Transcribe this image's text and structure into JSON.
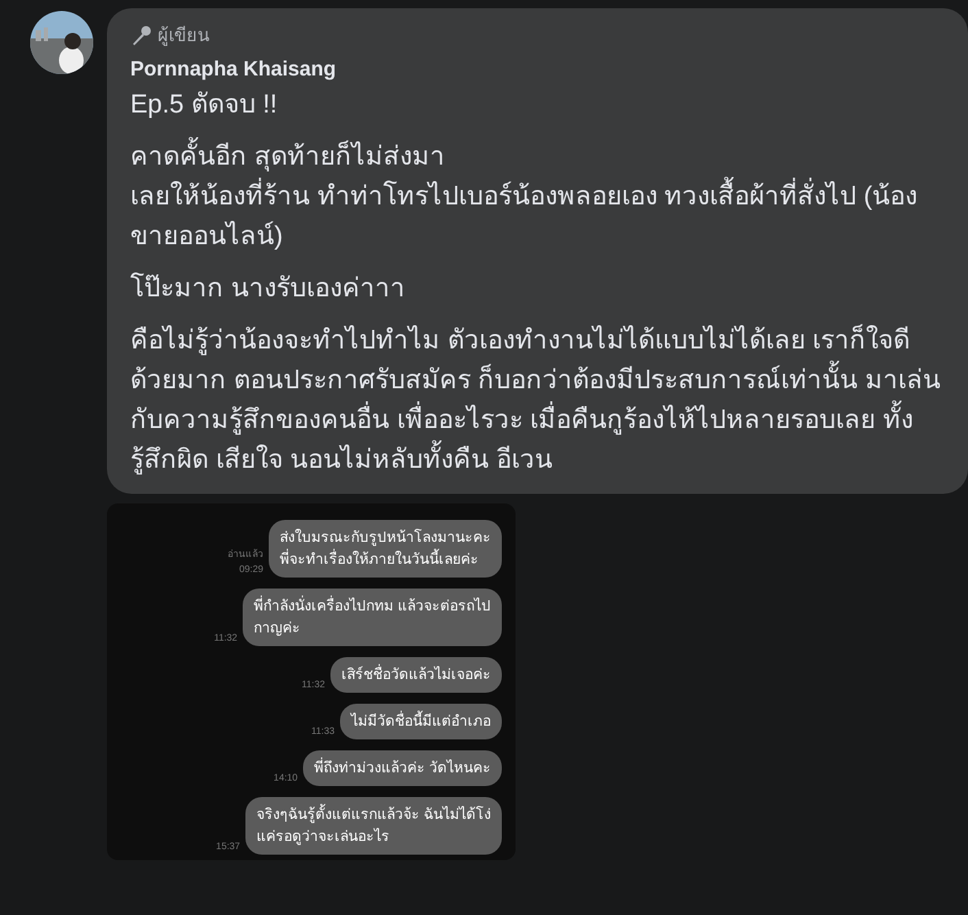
{
  "comment": {
    "badge": "ผู้เขียน",
    "author": "Pornnapha Khaisang",
    "paragraphs": [
      "Ep.5 ตัดจบ !!",
      "คาดคั้นอีก สุดท้ายก็ไม่ส่งมา\nเลยให้น้องที่ร้าน ทำท่าโทรไปเบอร์น้องพลอยเอง ทวงเสื้อผ้าที่สั่งไป (น้องขายออนไลน์)",
      "โป๊ะมาก นางรับเองค่าาา",
      "คือไม่รู้ว่าน้องจะทำไปทำไม ตัวเองทำงานไม่ได้แบบไม่ได้เลย เราก็ใจดีด้วยมาก ตอนประกาศรับสมัคร ก็บอกว่าต้องมีประสบการณ์เท่านั้น มาเล่นกับความรู้สึกของคนอื่น เพื่ออะไรวะ เมื่อคืนกูร้องไห้ไปหลายรอบเลย ทั้งรู้สึกผิด เสียใจ นอนไม่หลับทั้งคืน อีเวน"
    ]
  },
  "chat_screenshot": {
    "messages": [
      {
        "text": "ส่งใบมรณะกับรูปหน้าโลงมานะคะ\nพี่จะทำเรื่องให้ภายในวันนี้เลยค่ะ",
        "read": "อ่านแล้ว",
        "time": "09:29"
      },
      {
        "text": "พี่กำลังนั่งเครื่องไปกทม แล้วจะต่อรถไป\nกาญค่ะ",
        "time": "11:32"
      },
      {
        "text": "เสิร์ชชื่อวัดแล้วไม่เจอค่ะ",
        "time": "11:32"
      },
      {
        "text": "ไม่มีวัดชื่อนี้มีแต่อำเภอ",
        "time": "11:33"
      },
      {
        "text": "พี่ถึงท่าม่วงแล้วค่ะ วัดไหนคะ",
        "time": "14:10"
      },
      {
        "text": "จริงๆฉันรู้ตั้งแต่แรกแล้วจ้ะ ฉันไม่ได้โง่\nแค่รอดูว่าจะเล่นอะไร",
        "time": "15:37"
      }
    ]
  }
}
